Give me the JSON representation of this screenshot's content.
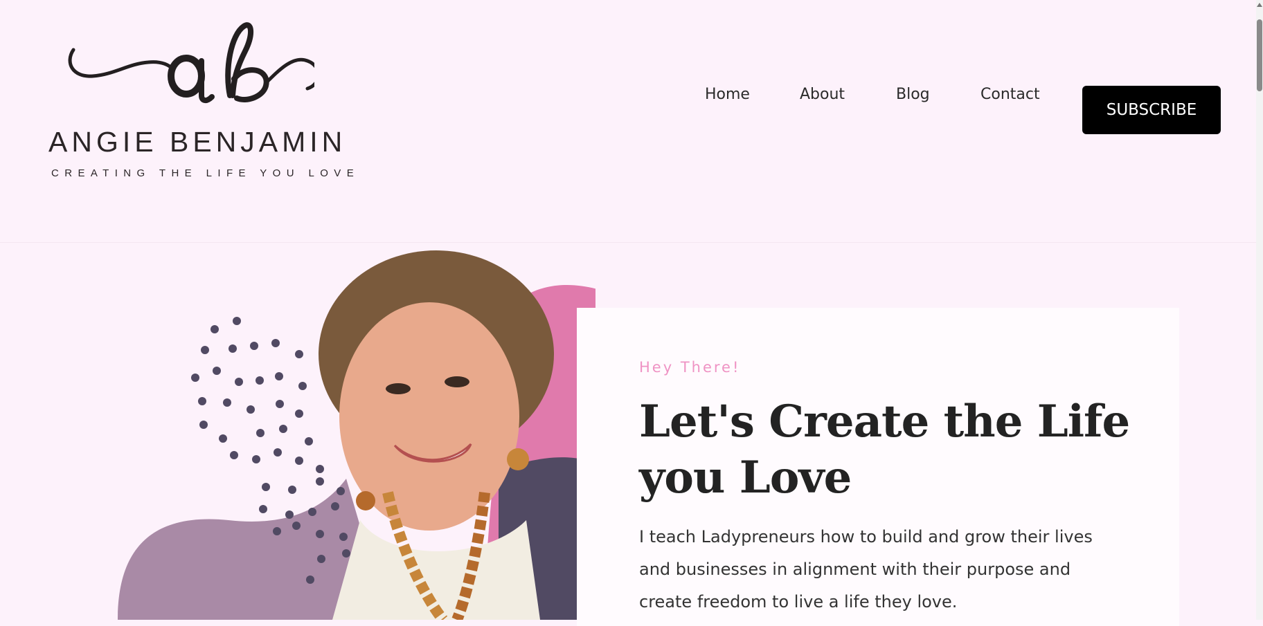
{
  "brand": {
    "monogram": "ab",
    "name": "ANGIE BENJAMIN",
    "tagline": "CREATING THE LIFE YOU LOVE"
  },
  "nav": {
    "items": [
      {
        "label": "Home"
      },
      {
        "label": "About"
      },
      {
        "label": "Blog"
      },
      {
        "label": "Contact"
      }
    ],
    "cta_label": "SUBSCRIBE"
  },
  "hero": {
    "eyebrow": "Hey There!",
    "headline": "Let's Create the Life you Love",
    "body": "I teach Ladypreneurs how to build and grow their lives and businesses in alignment with their purpose and create freedom to live a life they love."
  },
  "colors": {
    "background": "#fdf2fb",
    "accent_pink": "#e07aac",
    "accent_mauve": "#a98aa6",
    "accent_navy": "#514a63",
    "eyebrow": "#ef93c4"
  }
}
